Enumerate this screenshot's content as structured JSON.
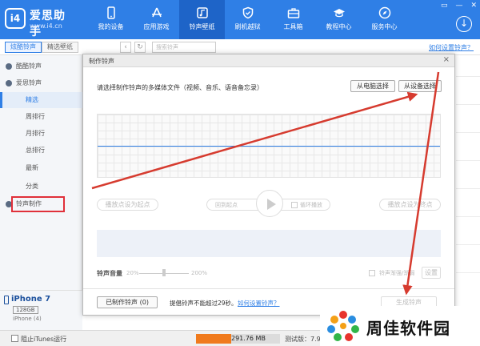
{
  "app": {
    "logo_badge": "i4",
    "name": "爱思助手",
    "url": "www.i4.cn",
    "window_controls": [
      "▭",
      "—",
      "✕"
    ]
  },
  "nav": [
    {
      "label": "我的设备",
      "icon": "phone-icon"
    },
    {
      "label": "应用游戏",
      "icon": "appstore-icon"
    },
    {
      "label": "铃声壁纸",
      "icon": "music-icon",
      "active": true
    },
    {
      "label": "刷机越狱",
      "icon": "shield-icon"
    },
    {
      "label": "工具箱",
      "icon": "toolbox-icon"
    },
    {
      "label": "教程中心",
      "icon": "graduation-cap-icon"
    },
    {
      "label": "服务中心",
      "icon": "compass-icon"
    }
  ],
  "subbar": {
    "tab_ringtones": "炫酷铃声",
    "tab_wallpapers": "精选壁纸",
    "back": "‹",
    "refresh": "↻",
    "search_placeholder": "搜索铃声",
    "help_link": "如何设置铃声？"
  },
  "sidebar": {
    "items": [
      {
        "label": "酷酷铃声",
        "level": "top"
      },
      {
        "label": "爱思铃声",
        "level": "top"
      },
      {
        "label": "精选",
        "level": "sub",
        "active": true
      },
      {
        "label": "周排行",
        "level": "sub"
      },
      {
        "label": "月排行",
        "level": "sub"
      },
      {
        "label": "总排行",
        "level": "sub"
      },
      {
        "label": "最新",
        "level": "sub"
      },
      {
        "label": "分类",
        "level": "sub"
      },
      {
        "label": "铃声制作",
        "level": "top"
      }
    ]
  },
  "device": {
    "name": "iPhone 7",
    "capacity": "128GB",
    "sub": "iPhone (4)"
  },
  "status": {
    "itunes_label": "阻止iTunes运行",
    "storage_text": "291.76 MB",
    "storage_fill_fraction": 0.42,
    "version": "测试版：7.98.2"
  },
  "dialog": {
    "title": "制作铃声",
    "close": "×",
    "prompt": "请选择制作铃声的多媒体文件（视频、音乐、语音备忘录）",
    "from_pc": "从电脑选择",
    "from_device": "从设备选择",
    "set_start": "播放点设为起点",
    "loop_start": "回到起点",
    "loop_play": "循环播放",
    "set_end": "播放点设为终点",
    "volume_label": "铃声音量",
    "volume_min": "20%",
    "volume_max": "200%",
    "fade_label": "铃声渐强/渐弱",
    "settings": "设置",
    "made_ringtones": "已制作铃声 (0)",
    "hint": "提倡铃声不能超过29秒。",
    "hint_link": "如何设置铃声？",
    "generate": "生成铃声"
  },
  "watermark": {
    "text": "周佳软件园"
  },
  "colors": {
    "brand_blue": "#2f7fe6",
    "arrow_red": "#d63b2f",
    "highlight_red": "#e0303a",
    "storage_orange": "#f07a1d"
  }
}
